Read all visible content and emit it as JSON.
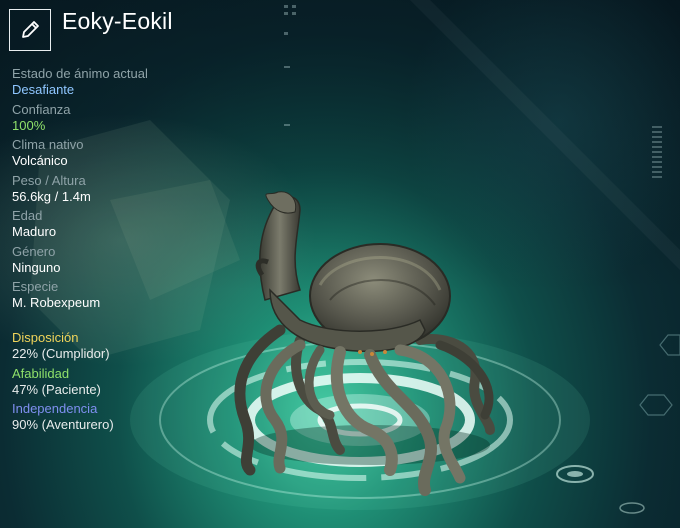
{
  "header": {
    "edit_icon": "pencil-icon",
    "creature_name": "Eoky-Eokil"
  },
  "stats": [
    {
      "label": "Estado de ánimo actual",
      "value": "Desafiante",
      "value_color": "#8fc6ff"
    },
    {
      "label": "Confianza",
      "value": "100%",
      "value_color": "#8fe16a"
    },
    {
      "label": "Clima nativo",
      "value": "Volcánico"
    },
    {
      "label": "Peso / Altura",
      "value": "56.6kg / 1.4m"
    },
    {
      "label": "Edad",
      "value": "Maduro"
    },
    {
      "label": "Género",
      "value": "Ninguno"
    },
    {
      "label": "Especie",
      "value": "M. Robexpeum"
    }
  ],
  "traits": [
    {
      "label": "Disposición",
      "value": "22% (Cumplidor)",
      "color": "#f0d45a"
    },
    {
      "label": "Afabilidad",
      "value": "47% (Paciente)",
      "color": "#8fe16a"
    },
    {
      "label": "Independencia",
      "value": "90% (Aventurero)",
      "color": "#7f8ff0"
    }
  ],
  "colors": {
    "background_dark": "#0b2c33",
    "platform_glow": "#3fc79f",
    "label_gray": "#8fa3a8"
  }
}
